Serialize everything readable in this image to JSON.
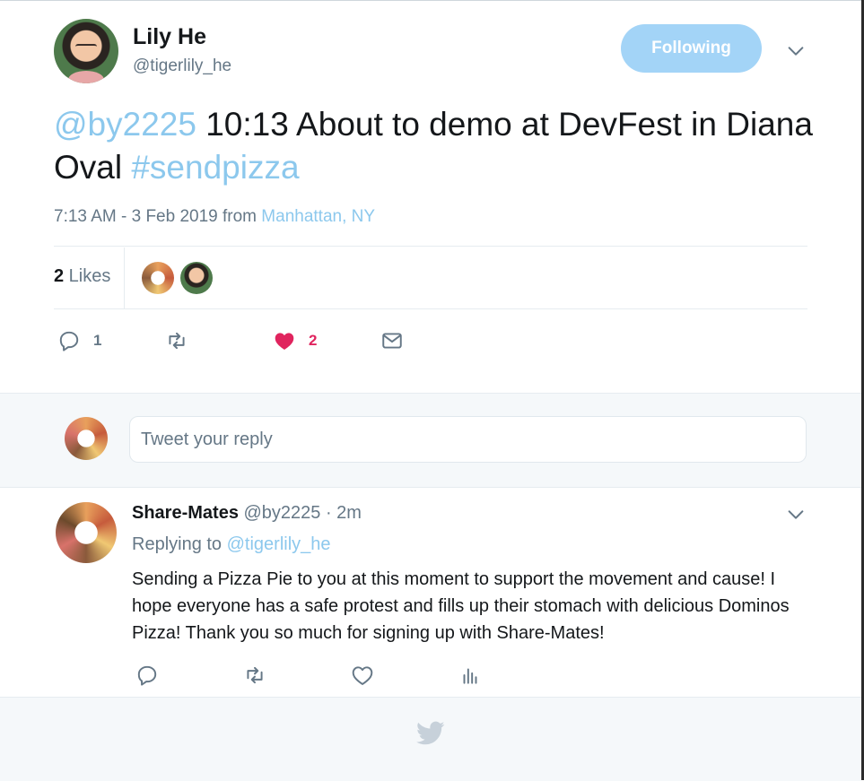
{
  "author": {
    "display_name": "Lily He",
    "handle": "@tigerlily_he",
    "follow_label": "Following"
  },
  "tweet": {
    "mention": "@by2225",
    "text": " 10:13 About to demo at DevFest in Diana Oval ",
    "hashtag": "#sendpizza",
    "timestamp": "7:13 AM - 3 Feb 2019 from ",
    "location": "Manhattan, NY"
  },
  "likes": {
    "count": "2",
    "label": " Likes"
  },
  "actions": {
    "reply_count": "1",
    "retweet_count": "",
    "like_count": "2"
  },
  "composer": {
    "placeholder": "Tweet your reply"
  },
  "reply": {
    "name": "Share-Mates",
    "handle_time": " @by2225 · 2m",
    "replying_label": "Replying to ",
    "replying_to": "@tigerlily_he",
    "body": "Sending a Pizza Pie to you at this moment to support the movement and cause! I hope everyone has a safe protest and fills up their stomach with delicious Dominos Pizza! Thank you so much for signing up with Share-Mates!"
  },
  "colors": {
    "accent": "#1da1f2",
    "like": "#e0245e",
    "muted": "#657786"
  },
  "icons": [
    "caret-down-icon",
    "reply-icon",
    "retweet-icon",
    "heart-icon",
    "envelope-icon",
    "analytics-icon",
    "twitter-bird-icon"
  ]
}
